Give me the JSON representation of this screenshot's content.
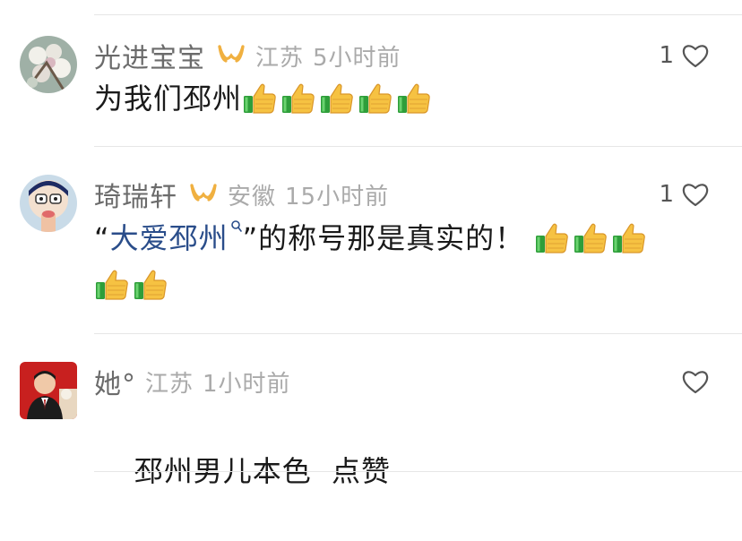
{
  "colors": {
    "username": "#6b6b6b",
    "meta": "#aaaaaa",
    "content": "#1a1a1a",
    "topic_link": "#2a4d8a",
    "badge": "#f0b040",
    "divider": "#e6e6e6"
  },
  "comments": [
    {
      "username": "光进宝宝",
      "location": "江苏",
      "time": "5小时前",
      "likes": "1",
      "text": "为我们邳州",
      "thumbs": 5,
      "avatar_icon": "blossom-avatar-icon"
    },
    {
      "username": "琦瑞轩",
      "location": "安徽",
      "time": "15小时前",
      "likes": "1",
      "quote_open": "“",
      "topic": "大爱邳州",
      "text_after": "”的称号那是真实的！",
      "thumbs_line1": 3,
      "thumbs_line2": 2,
      "avatar_icon": "cartoon-avatar-icon"
    },
    {
      "username": "她°",
      "location": "江苏",
      "time": "1小时前",
      "likes": "",
      "text": "邳州男儿本色  点赞",
      "avatar_icon": "man-portrait-avatar-icon"
    }
  ]
}
